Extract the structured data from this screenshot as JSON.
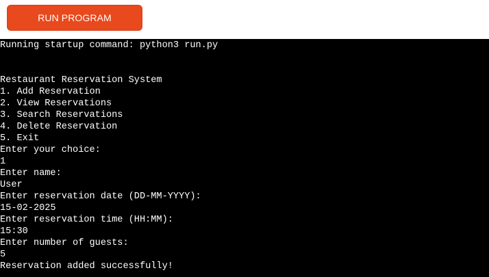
{
  "toolbar": {
    "run_button_label": "RUN PROGRAM"
  },
  "terminal": {
    "lines": [
      "Running startup command: python3 run.py",
      "",
      "",
      "Restaurant Reservation System",
      "1. Add Reservation",
      "2. View Reservations",
      "3. Search Reservations",
      "4. Delete Reservation",
      "5. Exit",
      "Enter your choice:",
      "1",
      "Enter name:",
      "User",
      "Enter reservation date (DD-MM-YYYY):",
      "15-02-2025",
      "Enter reservation time (HH:MM):",
      "15:30",
      "Enter number of guests:",
      "5",
      "Reservation added successfully!"
    ]
  },
  "colors": {
    "button_bg": "#e8491d",
    "terminal_bg": "#000000",
    "terminal_text": "#ffffff"
  }
}
